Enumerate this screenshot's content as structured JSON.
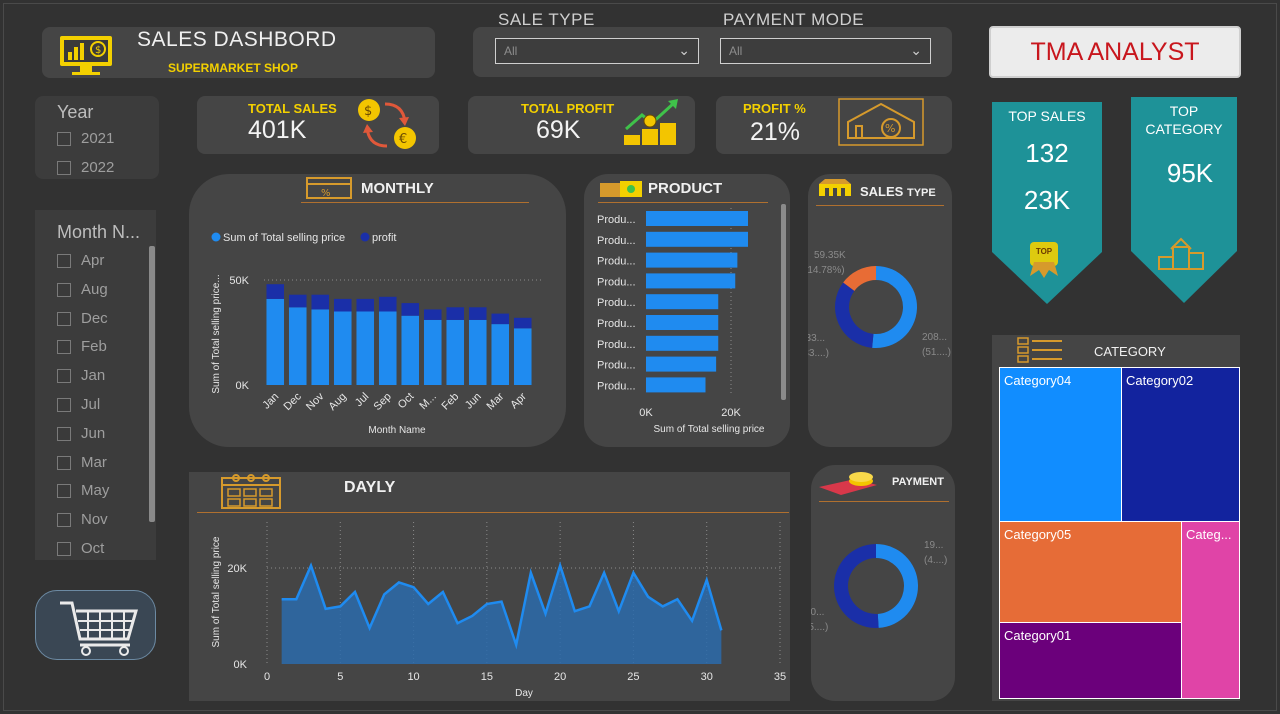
{
  "header": {
    "title": "SALES DASHBORD",
    "subtitle": "SUPERMARKET SHOP",
    "analyst": "TMA ANALYST"
  },
  "filters": {
    "sale_type": {
      "label": "SALE TYPE",
      "value": "All"
    },
    "payment_mode": {
      "label": "PAYMENT MODE",
      "value": "All"
    }
  },
  "slicers": {
    "year": {
      "title": "Year",
      "items": [
        "2021",
        "2022"
      ]
    },
    "month": {
      "title": "Month N...",
      "items": [
        "Apr",
        "Aug",
        "Dec",
        "Feb",
        "Jan",
        "Jul",
        "Jun",
        "Mar",
        "May",
        "Nov",
        "Oct"
      ]
    }
  },
  "kpis": {
    "total_sales": {
      "label": "TOTAL SALES",
      "value": "401K"
    },
    "total_profit": {
      "label": "TOTAL PROFIT",
      "value": "69K"
    },
    "profit_pct": {
      "label": "PROFIT %",
      "value": "21%"
    }
  },
  "ribbons": {
    "top_sales": {
      "label": "TOP SALES",
      "value1": "132",
      "value2": "23K",
      "badge": "TOP"
    },
    "top_category": {
      "label_line1": "TOP",
      "label_line2": "CATEGORY",
      "value": "95K"
    }
  },
  "panels": {
    "monthly": "MONTHLY",
    "product": "PRODUCT",
    "sales_type_a": "SALES",
    "sales_type_b": "TYPE",
    "daily": "DAYLY",
    "payment": "PAYMENT",
    "category": "CATEGORY"
  },
  "colors": {
    "bar_blue": "#1f8bf0",
    "bar_dark": "#1a2fa8",
    "accent_yellow": "#f3d000",
    "teal": "#1e9298",
    "orange": "#e86c35"
  },
  "chart_data": [
    {
      "type": "bar",
      "name": "monthly",
      "categories": [
        "Jan",
        "Dec",
        "Nov",
        "Aug",
        "Jul",
        "Sep",
        "Oct",
        "M...",
        "Feb",
        "Jun",
        "Mar",
        "Apr"
      ],
      "series": [
        {
          "name": "Sum of Total selling price",
          "values": [
            41000,
            37000,
            36000,
            35000,
            35000,
            35000,
            33000,
            31000,
            31000,
            31000,
            29000,
            27000
          ]
        },
        {
          "name": "profit",
          "values": [
            7000,
            6000,
            7000,
            6000,
            6000,
            7000,
            6000,
            5000,
            6000,
            6000,
            5000,
            5000
          ]
        }
      ],
      "stacked": true,
      "xlabel": "Month Name",
      "ylabel": "Sum of Total selling price...",
      "yticks": [
        "0K",
        "50K"
      ],
      "ylim": [
        0,
        55000
      ],
      "legend": "top-left"
    },
    {
      "type": "bar",
      "name": "product",
      "orientation": "horizontal",
      "categories": [
        "Produ...",
        "Produ...",
        "Produ...",
        "Produ...",
        "Produ...",
        "Produ...",
        "Produ...",
        "Produ...",
        "Produ..."
      ],
      "values": [
        24000,
        24000,
        21500,
        21000,
        17000,
        17000,
        17000,
        16500,
        14000
      ],
      "xlabel": "Sum of Total selling price",
      "xticks": [
        "0K",
        "20K"
      ],
      "xlim": [
        0,
        30000
      ]
    },
    {
      "type": "pie",
      "name": "sales_type",
      "donut": true,
      "labels": [
        "59.35K (14.78%)",
        "208... (51....)",
        "133... (33....)"
      ],
      "values": [
        14.78,
        51.5,
        33.7
      ],
      "colors": [
        "#e86c35",
        "#1f8bf0",
        "#1a2fa8"
      ]
    },
    {
      "type": "pie",
      "name": "payment",
      "donut": true,
      "labels": [
        "19... (4....)",
        "20... (5....)"
      ],
      "values": [
        49,
        51
      ],
      "colors": [
        "#1f8bf0",
        "#1a2fa8"
      ]
    },
    {
      "type": "area",
      "name": "daily",
      "x": [
        1,
        2,
        3,
        4,
        5,
        6,
        7,
        8,
        9,
        10,
        11,
        12,
        13,
        14,
        15,
        16,
        17,
        18,
        19,
        20,
        21,
        22,
        23,
        24,
        25,
        26,
        27,
        28,
        29,
        30,
        31
      ],
      "values": [
        13500,
        13500,
        20500,
        11500,
        12000,
        15000,
        7500,
        14500,
        17000,
        16000,
        12500,
        15000,
        8500,
        10000,
        12500,
        13000,
        4000,
        19000,
        10500,
        20500,
        11000,
        12000,
        19000,
        11000,
        19000,
        14000,
        12000,
        13500,
        9000,
        17500,
        7000
      ],
      "xlabel": "Day",
      "ylabel": "Sum of Total selling price",
      "xticks": [
        "0",
        "5",
        "10",
        "15",
        "20",
        "25",
        "30",
        "35"
      ],
      "yticks": [
        "0K",
        "20K"
      ],
      "xlim": [
        0,
        35
      ],
      "ylim": [
        0,
        22000
      ]
    },
    {
      "type": "treemap",
      "name": "category",
      "categories": [
        "Category04",
        "Category02",
        "Category05",
        "Categ...",
        "Category01"
      ],
      "colors": [
        "#118dff",
        "#12239e",
        "#e66c37",
        "#e044a7",
        "#6b007b"
      ]
    }
  ]
}
